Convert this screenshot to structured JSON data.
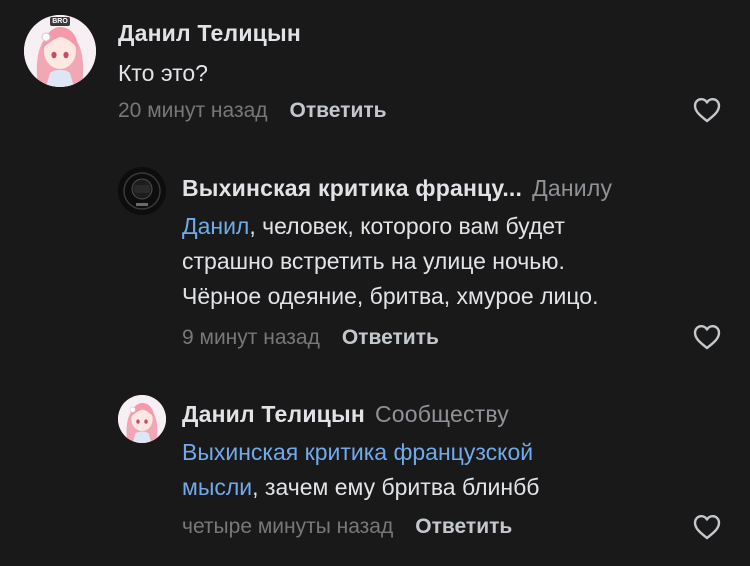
{
  "comments": [
    {
      "author": "Данил Телицын",
      "text": "Кто это?",
      "time": "20 минут назад",
      "reply_label": "Ответить",
      "avatar": "anime-girl-avatar",
      "avatar_badge": "BRO"
    },
    {
      "author": "Выхинская критика францу...",
      "reply_to": "Данилу",
      "mention": "Данил",
      "text_line1_rest": ", человек, которого вам будет",
      "text_line2": "страшно встретить на улице ночью.",
      "text_line3": "Чёрное одеяние, бритва, хмурое лицо.",
      "time": "9 минут назад",
      "reply_label": "Ответить",
      "avatar": "dark-circular-logo-avatar"
    },
    {
      "author": "Данил Телицын",
      "reply_to": "Сообществу",
      "mention_line1": "Выхинская критика французской",
      "mention_line2": "мысли",
      "text_rest": ", зачем ему бритва блинбб",
      "time": "четыре минуты назад",
      "reply_label": "Ответить",
      "avatar": "anime-girl-avatar"
    }
  ],
  "colors": {
    "background": "#19191a",
    "text": "#e1e3e6",
    "secondary": "#76787a",
    "link": "#71aaeb"
  }
}
